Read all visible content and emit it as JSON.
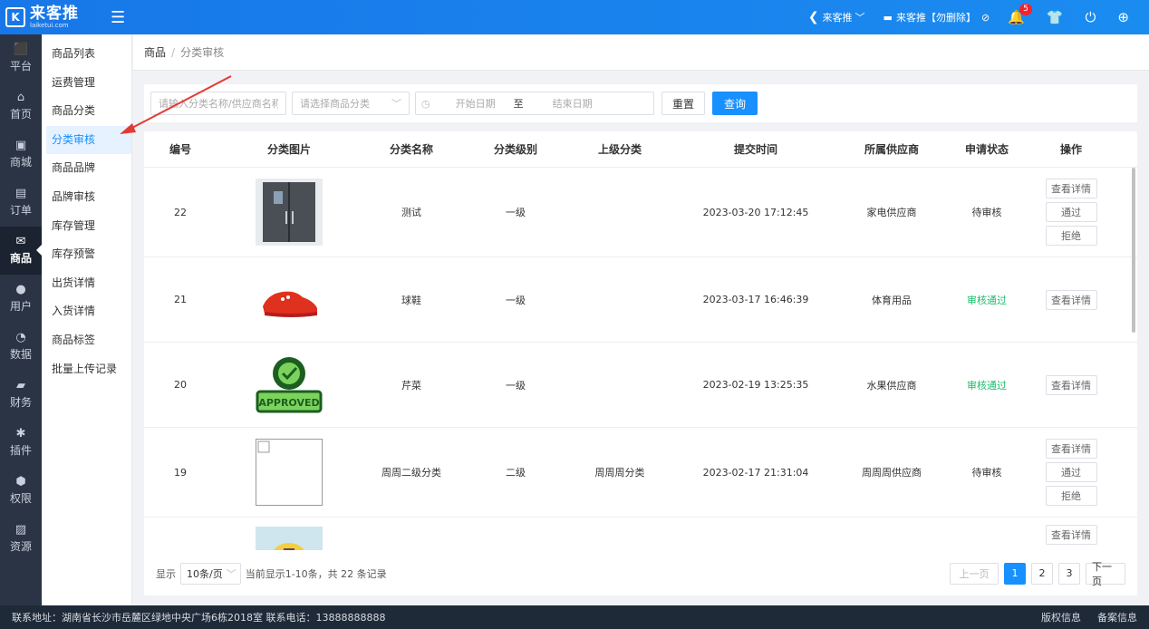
{
  "logo": {
    "mark": "K",
    "name": "来客推",
    "domain": "laiketui.com"
  },
  "topbar": {
    "store_label": "来客推",
    "store_dropdown": "﹀",
    "shop_label": "来客推【勿删除】",
    "notification_count": "5"
  },
  "iconnav": [
    {
      "label": "平台",
      "icon": "⬛"
    },
    {
      "label": "首页",
      "icon": "⌂"
    },
    {
      "label": "商城",
      "icon": "▣"
    },
    {
      "label": "订单",
      "icon": "▤"
    },
    {
      "label": "商品",
      "icon": "✉"
    },
    {
      "label": "用户",
      "icon": "●"
    },
    {
      "label": "数据",
      "icon": "◔"
    },
    {
      "label": "财务",
      "icon": "▰"
    },
    {
      "label": "插件",
      "icon": "✱"
    },
    {
      "label": "权限",
      "icon": "⬢"
    },
    {
      "label": "资源",
      "icon": "▨"
    }
  ],
  "submenu": [
    "商品列表",
    "运费管理",
    "商品分类",
    "分类审核",
    "商品品牌",
    "品牌审核",
    "库存管理",
    "库存预警",
    "出货详情",
    "入货详情",
    "商品标签",
    "批量上传记录"
  ],
  "breadcrumb": {
    "root": "商品",
    "sep": "/",
    "current": "分类审核"
  },
  "filters": {
    "keyword_placeholder": "请输入分类名称/供应商名称",
    "category_placeholder": "请选择商品分类",
    "start_date": "开始日期",
    "to": "至",
    "end_date": "结束日期",
    "reset": "重置",
    "query": "查询"
  },
  "table": {
    "headers": [
      "编号",
      "分类图片",
      "分类名称",
      "分类级别",
      "上级分类",
      "提交时间",
      "所属供应商",
      "申请状态",
      "操作"
    ],
    "rows": [
      {
        "id": "22",
        "name": "测试",
        "level": "一级",
        "parent": "",
        "time": "2023-03-20 17:12:45",
        "supplier": "家电供应商",
        "status": "待审核",
        "image": "fridge"
      },
      {
        "id": "21",
        "name": "球鞋",
        "level": "一级",
        "parent": "",
        "time": "2023-03-17 16:46:39",
        "supplier": "体育用品",
        "status": "审核通过",
        "image": "shoe"
      },
      {
        "id": "20",
        "name": "芹菜",
        "level": "一级",
        "parent": "",
        "time": "2023-02-19 13:25:35",
        "supplier": "水果供应商",
        "status": "审核通过",
        "image": "approved"
      },
      {
        "id": "19",
        "name": "周周二级分类",
        "level": "二级",
        "parent": "周周周分类",
        "time": "2023-02-17 21:31:04",
        "supplier": "周周周供应商",
        "status": "待审核",
        "image": "blank"
      },
      {
        "id": "",
        "name": "",
        "level": "",
        "parent": "",
        "time": "",
        "supplier": "",
        "status": "",
        "image": "yellow"
      }
    ],
    "actions": {
      "detail": "查看详情",
      "pass": "通过",
      "reject": "拒绝"
    },
    "approved_stamp": "APPROVED"
  },
  "pagination": {
    "show": "显示",
    "page_size": "10条/页",
    "summary": "当前显示1-10条，共 22 条记录",
    "prev": "上一页",
    "pages": [
      "1",
      "2",
      "3"
    ],
    "next": "下一页"
  },
  "footer": {
    "address": "联系地址：湖南省长沙市岳麓区绿地中央广场6栋2018室 联系电话：13888888888",
    "copyright": "版权信息",
    "record": "备案信息"
  },
  "colors": {
    "primary": "#1890ff",
    "topbar": "#1877e8",
    "sidebar": "#2b3445",
    "success": "#19be6b",
    "arrow": "#e53935"
  }
}
